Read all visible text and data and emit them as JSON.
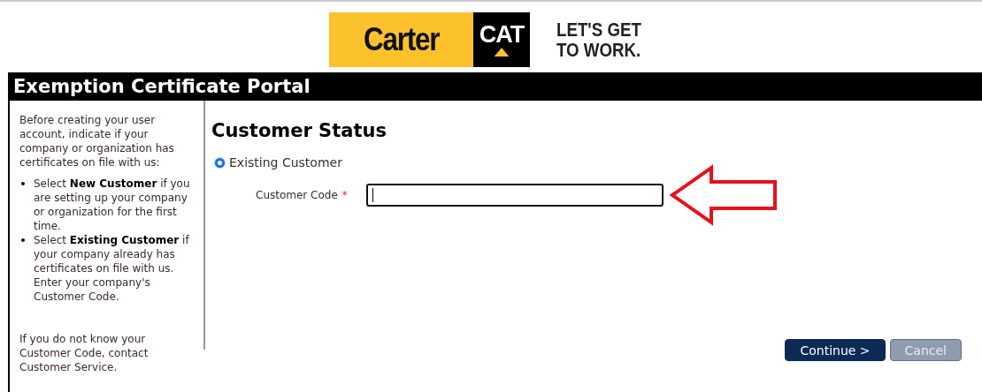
{
  "logo": {
    "brand": "Carter",
    "mark": "CAT",
    "slogan": [
      "LET'S GET",
      "TO WORK."
    ]
  },
  "portal_title": "Exemption Certificate Portal",
  "sidebar": {
    "intro": "Before creating your user account, indicate if your company or organization has certificates on file with us:",
    "bullets": [
      "Select **New Customer** if you are setting up your company or organization for the first time.",
      "Select **Existing Customer** if your company already has certificates on file with us. Enter your company's Customer Code."
    ],
    "note": "If you do not know your Customer Code, contact Customer Service."
  },
  "main": {
    "heading": "Customer Status",
    "options": [
      {
        "label": "Existing Customer",
        "selected": true
      }
    ],
    "field": {
      "label": "Customer Code",
      "required_mark": "*",
      "required": true,
      "focused": true
    },
    "buttons": [
      {
        "label": "Continue >",
        "disabled": false
      },
      {
        "label": "Cancel",
        "disabled": true
      }
    ]
  }
}
